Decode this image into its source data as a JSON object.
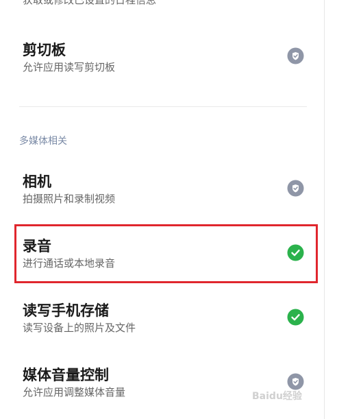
{
  "top_cut_text": "获取或修改已设置的日程信息",
  "items_before": [
    {
      "title": "剪切板",
      "subtitle": "允许应用读写剪切板",
      "status": "allowed-gray"
    }
  ],
  "section": {
    "header": "多媒体相关",
    "items": [
      {
        "title": "相机",
        "subtitle": "拍摄照片和录制视频",
        "status": "allowed-gray"
      },
      {
        "title": "录音",
        "subtitle": "进行通话或本地录音",
        "status": "allowed-green"
      },
      {
        "title": "读写手机存储",
        "subtitle": "读写设备上的照片及文件",
        "status": "allowed-green"
      },
      {
        "title": "媒体音量控制",
        "subtitle": "允许应用调整媒体音量",
        "status": "allowed-gray"
      }
    ]
  },
  "watermark": "Baidu经验",
  "colors": {
    "green": "#2bb24c",
    "gray": "#8f96a7",
    "highlight": "#e0262d"
  }
}
